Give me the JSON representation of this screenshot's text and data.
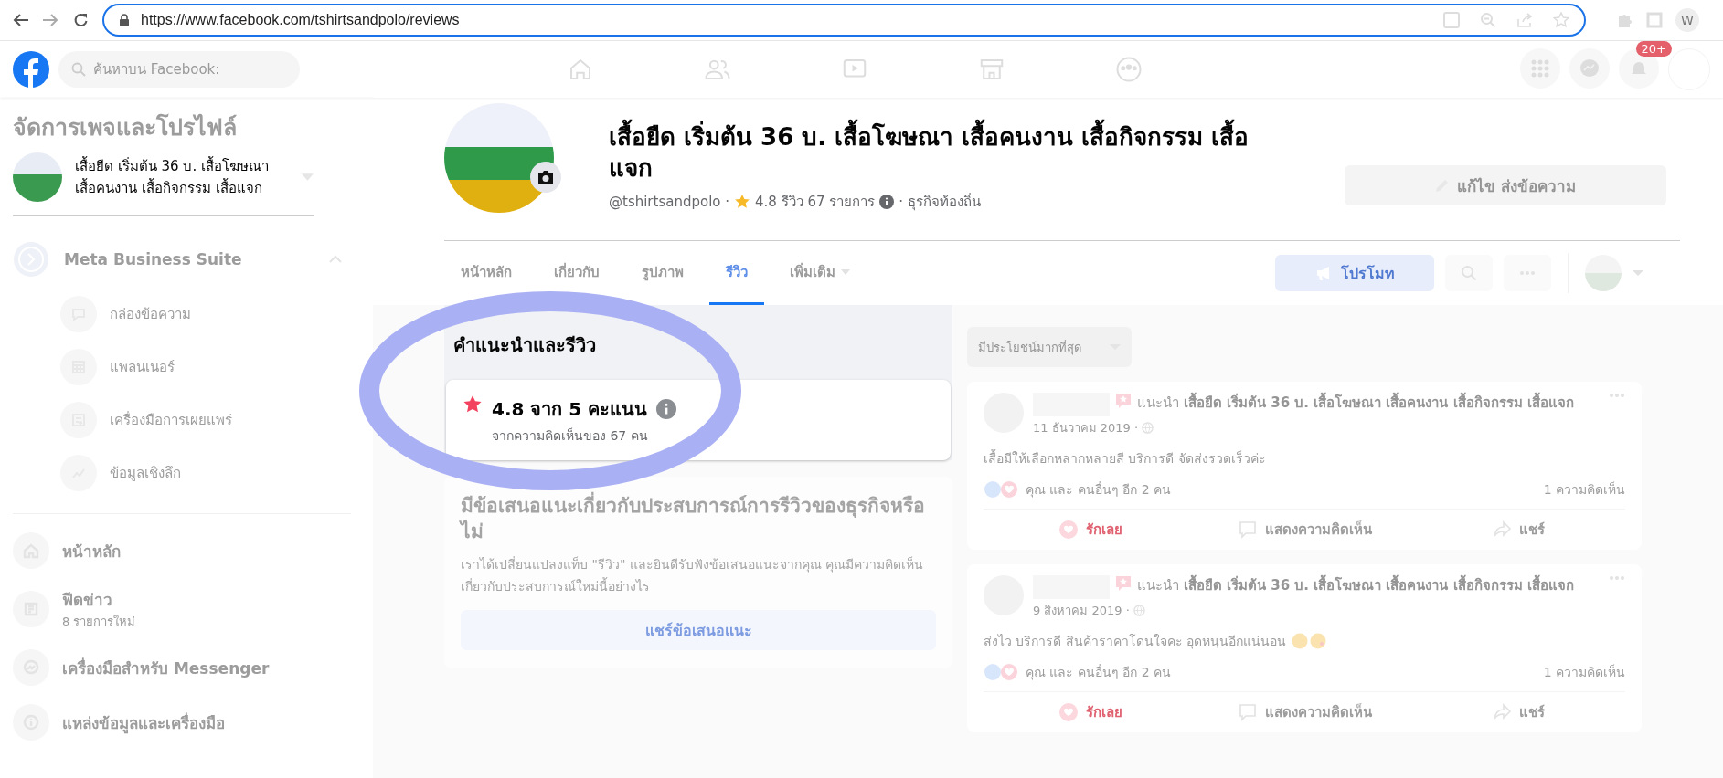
{
  "browser": {
    "url": "https://www.facebook.com/tshirtsandpolo/reviews",
    "profile": "W"
  },
  "fb_header": {
    "search_placeholder": "ค้นหาบน Facebook:",
    "notification_badge": "20+"
  },
  "sidebar": {
    "title": "จัดการเพจและโปรไฟล์",
    "page_name": "เสื้อยืด เริ่มต้น 36 บ. เสื้อโฆษณา เสื้อคนงาน เสื้อกิจกรรม เสื้อแจก",
    "business_suite": {
      "label": "Meta Business Suite",
      "expanded": true,
      "items": [
        {
          "kind": "inbox",
          "label": "กล่องข้อความ"
        },
        {
          "kind": "planner",
          "label": "แพลนเนอร์"
        },
        {
          "kind": "publishing",
          "label": "เครื่องมือการเผยแพร่"
        },
        {
          "kind": "insights",
          "label": "ข้อมูลเชิงลึก"
        }
      ]
    },
    "nav": [
      {
        "kind": "home",
        "label": "หน้าหลัก"
      },
      {
        "kind": "feed",
        "label": "ฟีดข่าว",
        "sub": "8 รายการใหม่"
      },
      {
        "kind": "messenger",
        "label": "เครื่องมือสำหรับ Messenger"
      },
      {
        "kind": "info",
        "label": "แหล่งข้อมูลและเครื่องมือ"
      }
    ]
  },
  "page_header": {
    "title": "เสื้อยืด เริ่มต้น 36 บ. เสื้อโฆษณา เสื้อคนงาน เสื้อกิจกรรม เสื้อแจก",
    "handle": "@tshirtsandpolo ·",
    "rating": "4.8 รีวิว 67 รายการ",
    "category": "· ธุรกิจท้องถิ่น",
    "edit_button": "แก้ไข ส่งข้อความ",
    "tabs": [
      {
        "label": "หน้าหลัก",
        "selected": false
      },
      {
        "label": "เกี่ยวกับ",
        "selected": false
      },
      {
        "label": "รูปภาพ",
        "selected": false
      },
      {
        "label": "รีวิว",
        "selected": true
      },
      {
        "label": "เพิ่มเติม",
        "selected": false
      }
    ],
    "promote_button": "โปรโมท"
  },
  "reviews": {
    "heading": "คำแนะนำและรีวิว",
    "score": "4.8 จาก 5 คะแนน",
    "based_on": "จากความคิดเห็นของ 67 คน",
    "feedback": {
      "title": "มีข้อเสนอแนะเกี่ยวกับประสบการณ์การรีวิวของธุรกิจหรือไม่",
      "body": "เราได้เปลี่ยนแปลงแท็บ \"รีวิว\" และยินดีรับฟังข้อเสนอแนะจากคุณ คุณมีความคิดเห็นเกี่ยวกับประสบการณ์ใหม่นี้อย่างไร",
      "button": "แชร์ข้อเสนอแนะ"
    }
  },
  "sort": {
    "label": "มีประโยชน์มากที่สุด"
  },
  "posts": [
    {
      "recommends": "แนะนำ",
      "page": "เสื้อยืด เริ่มต้น 36 บ. เสื้อโฆษณา เสื้อคนงาน เสื้อกิจกรรม เสื้อแจก",
      "date": "11 ธันวาคม 2019 ·",
      "text": "เสื้อมีให้เลือกหลากหลายสี บริการดี จัดส่งรวดเร็วค่ะ",
      "emoji": false,
      "reactions": "คุณ และ คนอื่นๆ อีก 2 คน",
      "comments": "1 ความคิดเห็น",
      "loved": true,
      "actions": [
        "รักเลย",
        "แสดงความคิดเห็น",
        "แชร์"
      ]
    },
    {
      "recommends": "แนะนำ",
      "page": "เสื้อยืด เริ่มต้น 36 บ. เสื้อโฆษณา เสื้อคนงาน เสื้อกิจกรรม เสื้อแจก",
      "date": "9 สิงหาคม 2019 ·",
      "text": "ส่งไว บริการดี สินค้าราคาโดนใจคะ อุดหนุนอีกแน่นอน",
      "emoji": true,
      "reactions": "คุณ และ คนอื่นๆ อีก 2 คน",
      "comments": "1 ความคิดเห็น",
      "loved": true,
      "actions": [
        "รักเลย",
        "แสดงความคิดเห็น",
        "แชร์"
      ]
    }
  ]
}
